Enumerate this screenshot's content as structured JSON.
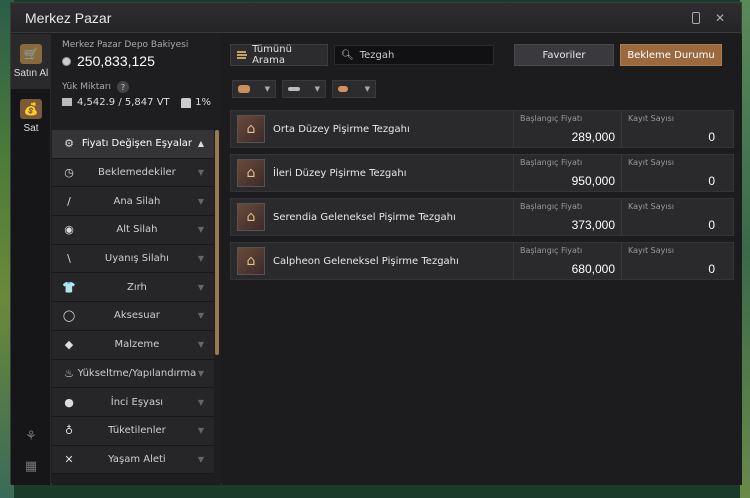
{
  "window": {
    "title": "Merkez Pazar"
  },
  "side_tabs": [
    {
      "label": "Satın Al",
      "icon": "cart-icon"
    },
    {
      "label": "Sat",
      "icon": "bag-icon"
    }
  ],
  "balance": {
    "label": "Merkez Pazar Depo Bakiyesi",
    "value": "250,833,125"
  },
  "weight": {
    "label": "Yük Miktarı",
    "help": "?",
    "value": "4,542.9 / 5,847 VT",
    "percent": "1%"
  },
  "categories": [
    {
      "label": "Fiyatı Değişen Eşyalar",
      "icon": "gear-icon",
      "glyph": "⚙",
      "arrow": "▲"
    },
    {
      "label": "Beklemedekiler",
      "icon": "clock-icon",
      "glyph": "◷",
      "arrow": "▼"
    },
    {
      "label": "Ana Silah",
      "icon": "sword-icon",
      "glyph": "/",
      "arrow": "▼"
    },
    {
      "label": "Alt Silah",
      "icon": "shield-icon",
      "glyph": "◉",
      "arrow": "▼"
    },
    {
      "label": "Uyanış Silahı",
      "icon": "awakening-icon",
      "glyph": "\\",
      "arrow": "▼"
    },
    {
      "label": "Zırh",
      "icon": "armor-icon",
      "glyph": "👕",
      "arrow": "▼"
    },
    {
      "label": "Aksesuar",
      "icon": "ring-icon",
      "glyph": "◯",
      "arrow": "▼"
    },
    {
      "label": "Malzeme",
      "icon": "material-icon",
      "glyph": "◆",
      "arrow": "▼"
    },
    {
      "label": "Yükseltme/Yapılandırma",
      "icon": "flame-icon",
      "glyph": "♨",
      "arrow": "▼"
    },
    {
      "label": "İnci Eşyası",
      "icon": "pearl-icon",
      "glyph": "●",
      "arrow": "▼"
    },
    {
      "label": "Tüketilenler",
      "icon": "potion-icon",
      "glyph": "♁",
      "arrow": "▼"
    },
    {
      "label": "Yaşam Aleti",
      "icon": "tools-icon",
      "glyph": "✕",
      "arrow": "▼"
    }
  ],
  "toolbar": {
    "search_all": "Tümünü Arama",
    "search_value": "Tezgah",
    "favorites": "Favoriler",
    "waiting": "Bekleme Durumu"
  },
  "columns": {
    "price": "Başlangıç Fiyatı",
    "count": "Kayıt Sayısı"
  },
  "items": [
    {
      "name": "Orta Düzey Pişirme Tezgahı",
      "price": "289,000",
      "count": "0"
    },
    {
      "name": "İleri Düzey Pişirme Tezgahı",
      "price": "950,000",
      "count": "0"
    },
    {
      "name": "Serendia Geleneksel Pişirme Tezgahı",
      "price": "373,000",
      "count": "0"
    },
    {
      "name": "Calpheon Geleneksel Pişirme Tezgahı",
      "price": "680,000",
      "count": "0"
    }
  ]
}
